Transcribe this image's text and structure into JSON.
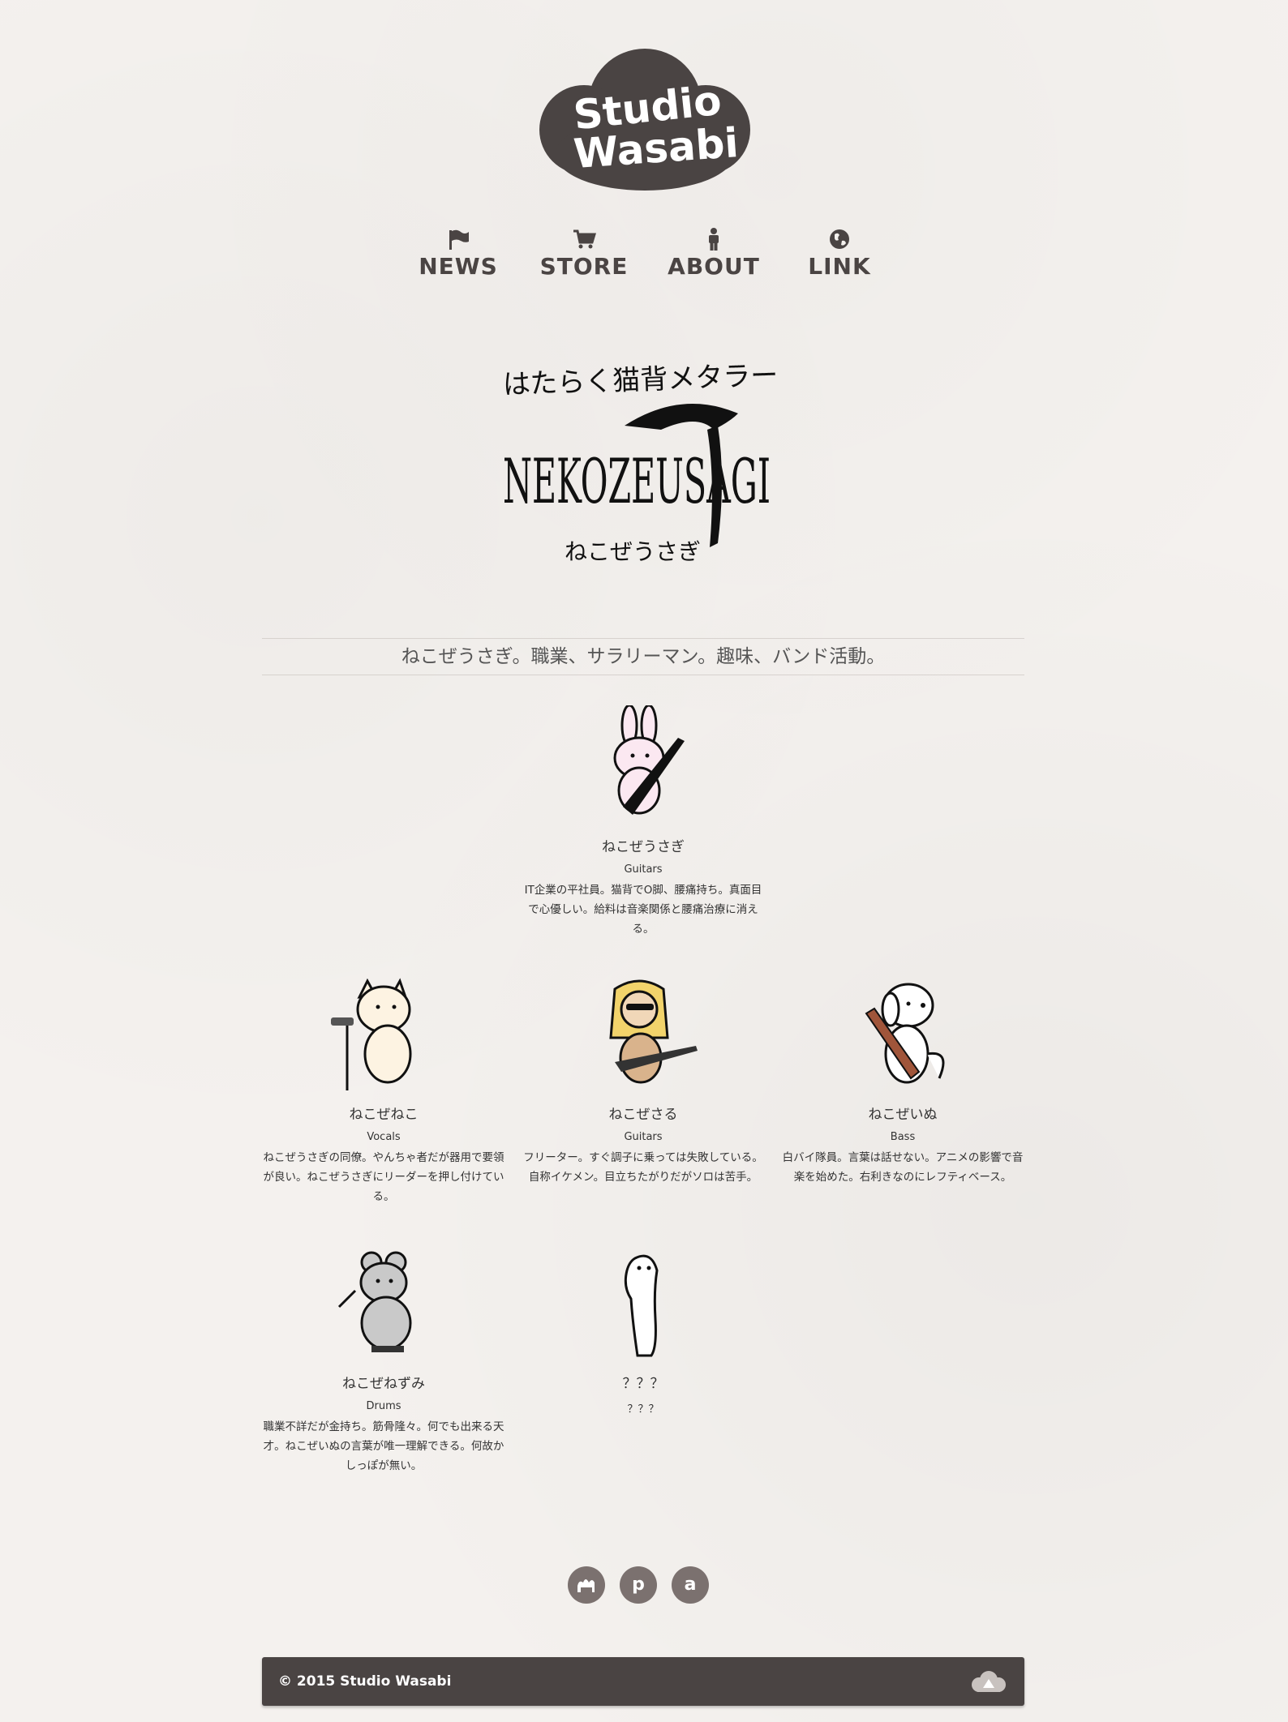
{
  "brand": {
    "line1": "Studio",
    "line2": "Wasabi"
  },
  "nav": [
    {
      "label": "NEWS",
      "icon": "flag-icon"
    },
    {
      "label": "STORE",
      "icon": "cart-icon"
    },
    {
      "label": "ABOUT",
      "icon": "person-icon"
    },
    {
      "label": "LINK",
      "icon": "globe-icon"
    }
  ],
  "title_logo": {
    "top": "はたらく猫背メタラー",
    "main": "NEKOZEUSAGI",
    "sub": "ねこぜうさぎ"
  },
  "tagline": "ねこぜうさぎ。職業、サラリーマン。趣味、バンド活動。",
  "members": [
    {
      "name": "ねこぜうさぎ",
      "role": "Guitars",
      "desc": "IT企業の平社員。猫背でO脚、腰痛持ち。真面目で心優しい。給料は音楽関係と腰痛治療に消える。",
      "icon": "rabbit-guitarist-icon"
    },
    {
      "name": "ねこぜねこ",
      "role": "Vocals",
      "desc": "ねこぜうさぎの同僚。やんちゃ者だが器用で要領が良い。ねこぜうさぎにリーダーを押し付けている。",
      "icon": "cat-vocalist-icon"
    },
    {
      "name": "ねこぜさる",
      "role": "Guitars",
      "desc": "フリーター。すぐ調子に乗っては失敗している。自称イケメン。目立ちたがりだがソロは苦手。",
      "icon": "monkey-guitarist-icon"
    },
    {
      "name": "ねこぜいぬ",
      "role": "Bass",
      "desc": "白バイ隊員。言葉は話せない。アニメの影響で音楽を始めた。右利きなのにレフティベース。",
      "icon": "dog-bassist-icon"
    },
    {
      "name": "ねこぜねずみ",
      "role": "Drums",
      "desc": "職業不詳だが金持ち。筋骨隆々。何でも出来る天才。ねこぜいぬの言葉が唯一理解できる。何故かしっぽが無い。",
      "icon": "mouse-drummer-icon"
    },
    {
      "name": "？？？",
      "role": "？？？",
      "desc": "",
      "icon": "mystery-figure-icon"
    }
  ],
  "social": [
    {
      "icon": "camel-icon"
    },
    {
      "icon": "pixiv-icon",
      "glyph": "p"
    },
    {
      "icon": "amazon-icon",
      "glyph": "a"
    }
  ],
  "footer": {
    "copyright": "© 2015 Studio Wasabi"
  },
  "colors": {
    "brand_dark": "#4a4443",
    "social_bg": "#7b716f",
    "page_bg": "#f4f1ee"
  }
}
